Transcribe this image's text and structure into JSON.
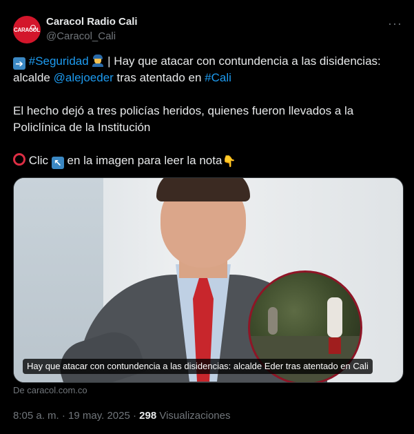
{
  "author": {
    "avatar_text": "CARACOL",
    "name": "Caracol Radio Cali",
    "handle": "@Caracol_Cali"
  },
  "menu_icon": "more-horizontal-icon",
  "tweet": {
    "hashtag_seguridad": "#Seguridad",
    "line1_rest": " | Hay que atacar con contundencia a las disidencias:",
    "alcalde": "alcalde ",
    "mention": "@alejoeder",
    "tras": " tras atentado en ",
    "hashtag_cali": "#Cali",
    "paragraph2": "El hecho dejó a tres policías heridos, quienes fueron llevados a la Policlínica de la Institución",
    "clic": " Clic ",
    "line3_rest": " en la imagen para leer la nota"
  },
  "media": {
    "caption": "Hay que atacar con contundencia a las disidencias: alcalde Eder tras atentado en Cali",
    "source": "De caracol.com.co"
  },
  "meta": {
    "time_date": "8:05 a. m. · 19 may. 2025 · ",
    "views_count": "298",
    "views_label": " Visualizaciones"
  },
  "colors": {
    "background": "#000000",
    "text": "#e7e9ea",
    "muted": "#71767b",
    "link": "#1d9bf0",
    "brand": "#d3162b"
  }
}
